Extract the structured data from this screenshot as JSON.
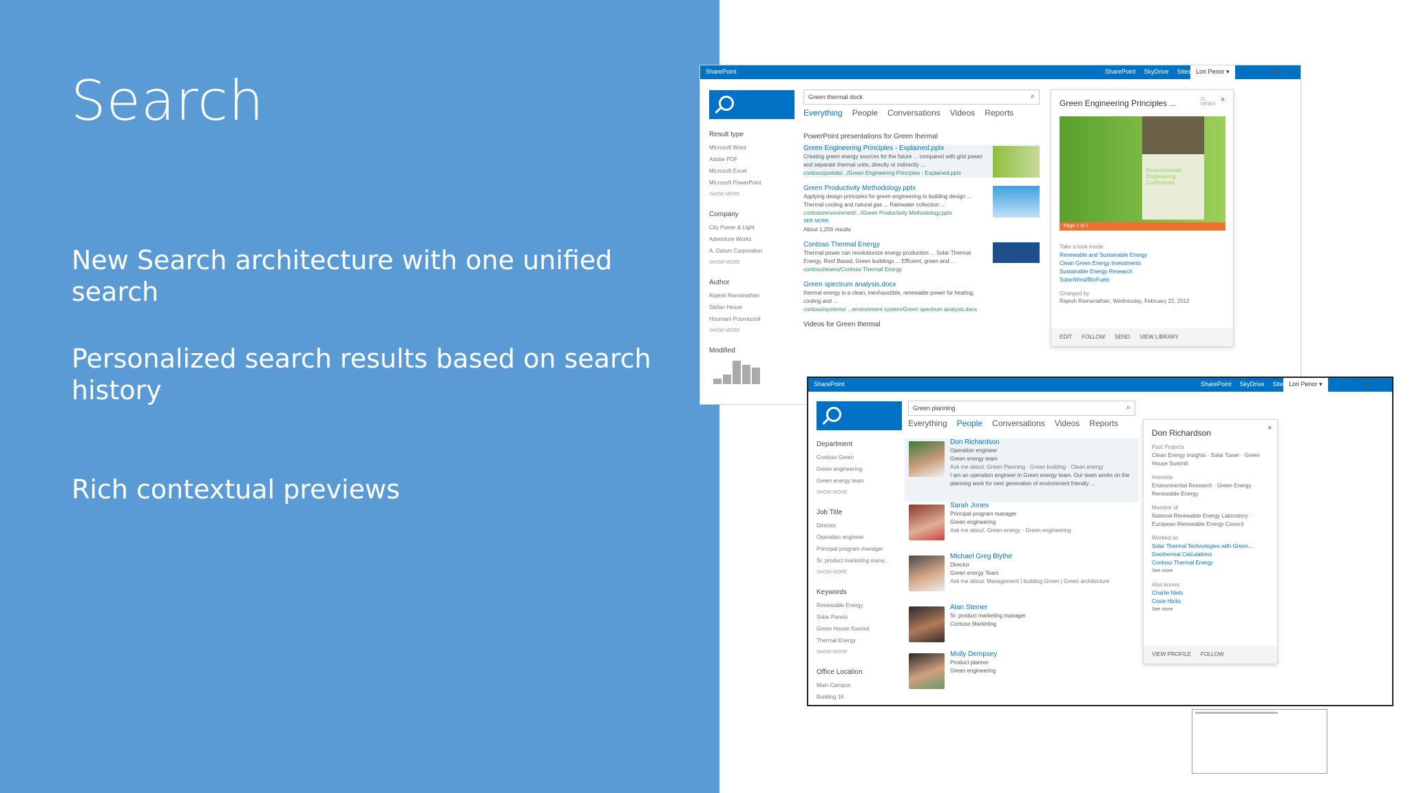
{
  "slide": {
    "title": "Search",
    "bullets": [
      "New Search architecture with one unified search",
      "Personalized search results based on search history",
      "Rich contextual previews"
    ]
  },
  "colors": {
    "left_panel": "#5b9bd5",
    "sharepoint_blue": "#0072c6"
  },
  "shot1": {
    "brand": "SharePoint",
    "links": [
      "SharePoint",
      "SkyDrive",
      "Sites"
    ],
    "user": "Lori Penor ▾",
    "search_value": "Green thermal dock",
    "tabs": [
      "Everything",
      "People",
      "Conversations",
      "Videos",
      "Reports"
    ],
    "refiners": [
      {
        "heading": "Result type",
        "items": [
          "Microsoft Word",
          "Adobe PDF",
          "Microsoft Excel",
          "Microsoft PowerPoint"
        ],
        "more": "SHOW MORE"
      },
      {
        "heading": "Company",
        "items": [
          "City Power & Light",
          "Adventure Works",
          "A. Datum Corporation"
        ],
        "more": "SHOW MORE"
      },
      {
        "heading": "Author",
        "items": [
          "Rajesh Ramanathan",
          "Stefan Hesse",
          "Houmam Pourrassoli"
        ],
        "more": "SHOW MORE"
      },
      {
        "heading": "Modified",
        "items": [],
        "more": ""
      }
    ],
    "results_heading": "PowerPoint presentations for Green thermal",
    "results": [
      {
        "title": "Green Engineering Principles - Explained.pptx",
        "body": "Creating green energy sources for the future ... compared with grid power and separate thermal units, directly or indirectly ...",
        "url": "contoso/portals/.../Green Engineering Principles - Explained.pptx"
      },
      {
        "title": "Green Productivity Methodology.pptx",
        "body": "Applying design principles for green engineering to building design ... Thermal cooling and natural gas ... Rainwater collection ...",
        "url": "contoso/environment/.../Green Productivity Methodology.pptx"
      },
      {
        "title": "Contoso Thermal Energy",
        "body": "Thermal power can revolutionize energy production ... Solar Thermal Energy, Roof Based, Green buildings ... Efficient, green and ...",
        "url": "contoso/teams/Contoso Thermal Energy"
      },
      {
        "title": "Green spectrum analysis.docx",
        "body": "thermal energy is a clean, inexhaustible, renewable power for heating, cooling and ...",
        "url": "contoso/systems/ ...environment system/Green spectrum analysis.docx"
      }
    ],
    "see_more": "SEE MORE",
    "about": "About 1,256 results",
    "videos_heading": "Videos for Green thermal",
    "preview": {
      "title": "Green Engineering Principles ...",
      "views": "21 VIEWS",
      "slide_text": "Environmental Engineering Conference",
      "page": "Page 1 of 1",
      "label_inside": "Take a look inside",
      "inside_links": [
        "Renewable and Sustainable Energy",
        "Clean Green Energy Investments",
        "Sustainable Energy Research",
        "Solar/Wind/BioFuels"
      ],
      "label_changed": "Changed by",
      "changed": "Rajesh Ramanathan, Wednesday, February 22, 2012",
      "actions": [
        "EDIT",
        "FOLLOW",
        "SEND",
        "VIEW LIBRARY"
      ]
    }
  },
  "shot2": {
    "brand": "SharePoint",
    "links": [
      "SharePoint",
      "SkyDrive",
      "Sites"
    ],
    "user": "Lori Penor ▾",
    "search_value": "Green planning",
    "tabs": [
      "Everything",
      "People",
      "Conversations",
      "Videos",
      "Reports"
    ],
    "refiners": [
      {
        "heading": "Department",
        "items": [
          "Contoso Green",
          "Green engineering",
          "Green energy team"
        ],
        "more": "SHOW MORE"
      },
      {
        "heading": "Job Title",
        "items": [
          "Director",
          "Operation engineer",
          "Principal program manager",
          "Sr. product marketing mana..."
        ],
        "more": "SHOW MORE"
      },
      {
        "heading": "Keywords",
        "items": [
          "Renewable Energy",
          "Solar Panels",
          "Green House Summit",
          "Thermal Energy"
        ],
        "more": "SHOW MORE"
      },
      {
        "heading": "Office Location",
        "items": [
          "Main Campus",
          "Building 16"
        ],
        "more": ""
      }
    ],
    "people": [
      {
        "name": "Don Richardson",
        "title": "Operation engineer",
        "dept": "Green energy team",
        "ask": "Ask me about: Green Planning · Green building · Clean energy",
        "about": "I am an operation engineer in Green energy team. Our team works on the planning work for next generation of environment friendly ..."
      },
      {
        "name": "Sarah Jones",
        "title": "Principal program manager",
        "dept": "Green engineering",
        "ask": "Ask me about: Green energy · Green engineering",
        "about": ""
      },
      {
        "name": "Michael Greg Blythe",
        "title": "Director",
        "dept": "Green energy Team",
        "ask": "Ask me about: Management | building Green | Green architecture",
        "about": ""
      },
      {
        "name": "Alan Steiner",
        "title": "Sr. product marketing manager",
        "dept": "Contoso Marketing",
        "ask": "",
        "about": ""
      },
      {
        "name": "Molly Dempsey",
        "title": "Product planner",
        "dept": "Green engineering",
        "ask": "",
        "about": ""
      }
    ],
    "preview": {
      "name": "Don Richardson",
      "label_past": "Past Projects",
      "past": "Clean Energy Insights · Solar Tower · Green House Summit",
      "label_interests": "Interests",
      "interests": "Environmental Research · Green Energy · Renewable Energy",
      "label_member": "Member of",
      "member": "National Renewable Energy Laboratory · European Renewable Energy Council",
      "label_worked": "Worked on",
      "worked": [
        "Solar Thermal Technologies with Green...",
        "Geothermal Calculations",
        "Contoso Thermal Energy"
      ],
      "see_more": "See more",
      "label_knows": "Also knows",
      "knows": [
        "Charlie Niels",
        "Cosie Hicks"
      ],
      "actions": [
        "VIEW PROFILE",
        "FOLLOW"
      ]
    }
  }
}
